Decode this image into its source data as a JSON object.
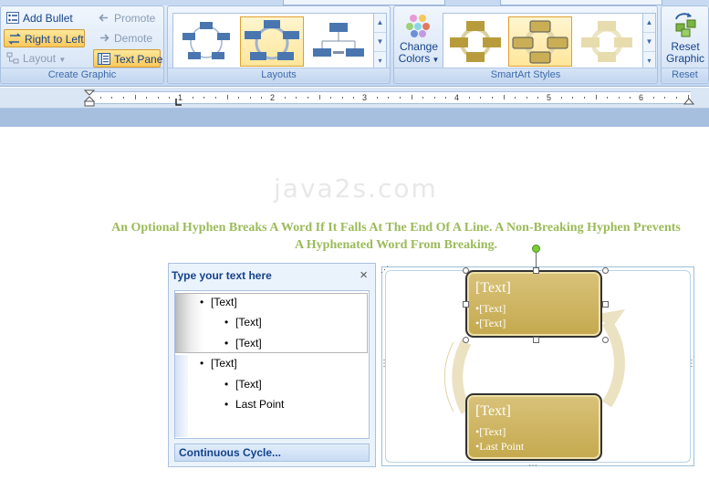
{
  "ribbon": {
    "create_graphic": {
      "label": "Create Graphic",
      "add_bullet": "Add Bullet",
      "right_to_left": "Right to Left",
      "layout": "Layout",
      "promote": "Promote",
      "demote": "Demote",
      "text_pane": "Text Pane"
    },
    "layouts": {
      "label": "Layouts",
      "selected_index": 1
    },
    "smartart_styles": {
      "label": "SmartArt Styles",
      "change_colors_line1": "Change",
      "change_colors_line2": "Colors",
      "selected_index": 1
    },
    "reset": {
      "label": "Reset",
      "button_line1": "Reset",
      "button_line2": "Graphic"
    }
  },
  "ruler": {
    "numbers": [
      "1",
      "2",
      "3",
      "4",
      "5",
      "6"
    ]
  },
  "document": {
    "watermark": "java2s.com",
    "paragraph_line1": "An Optional Hyphen Breaks A Word If It Falls At The End Of A Line. A Non-Breaking Hyphen Prevents",
    "paragraph_line2": "A Hyphenated Word From Breaking."
  },
  "text_pane": {
    "title": "Type your text here",
    "close": "×",
    "items": [
      {
        "text": "[Text]",
        "level": 1
      },
      {
        "text": "[Text]",
        "level": 2
      },
      {
        "text": "[Text]",
        "level": 2
      },
      {
        "text": "[Text]",
        "level": 1
      },
      {
        "text": "[Text]",
        "level": 2
      },
      {
        "text": "Last Point",
        "level": 2
      }
    ],
    "footer": "Continuous Cycle..."
  },
  "smartart": {
    "nodes": [
      {
        "title": "[Text]",
        "bullets": [
          "[Text]",
          "[Text]"
        ]
      },
      {
        "title": "[Text]",
        "bullets": [
          "[Text]",
          "Last Point"
        ]
      }
    ]
  },
  "colors": {
    "accent_gold": "#c9ae56",
    "paragraph_green": "#9bbb59",
    "ribbon_blue": "#15428b"
  }
}
